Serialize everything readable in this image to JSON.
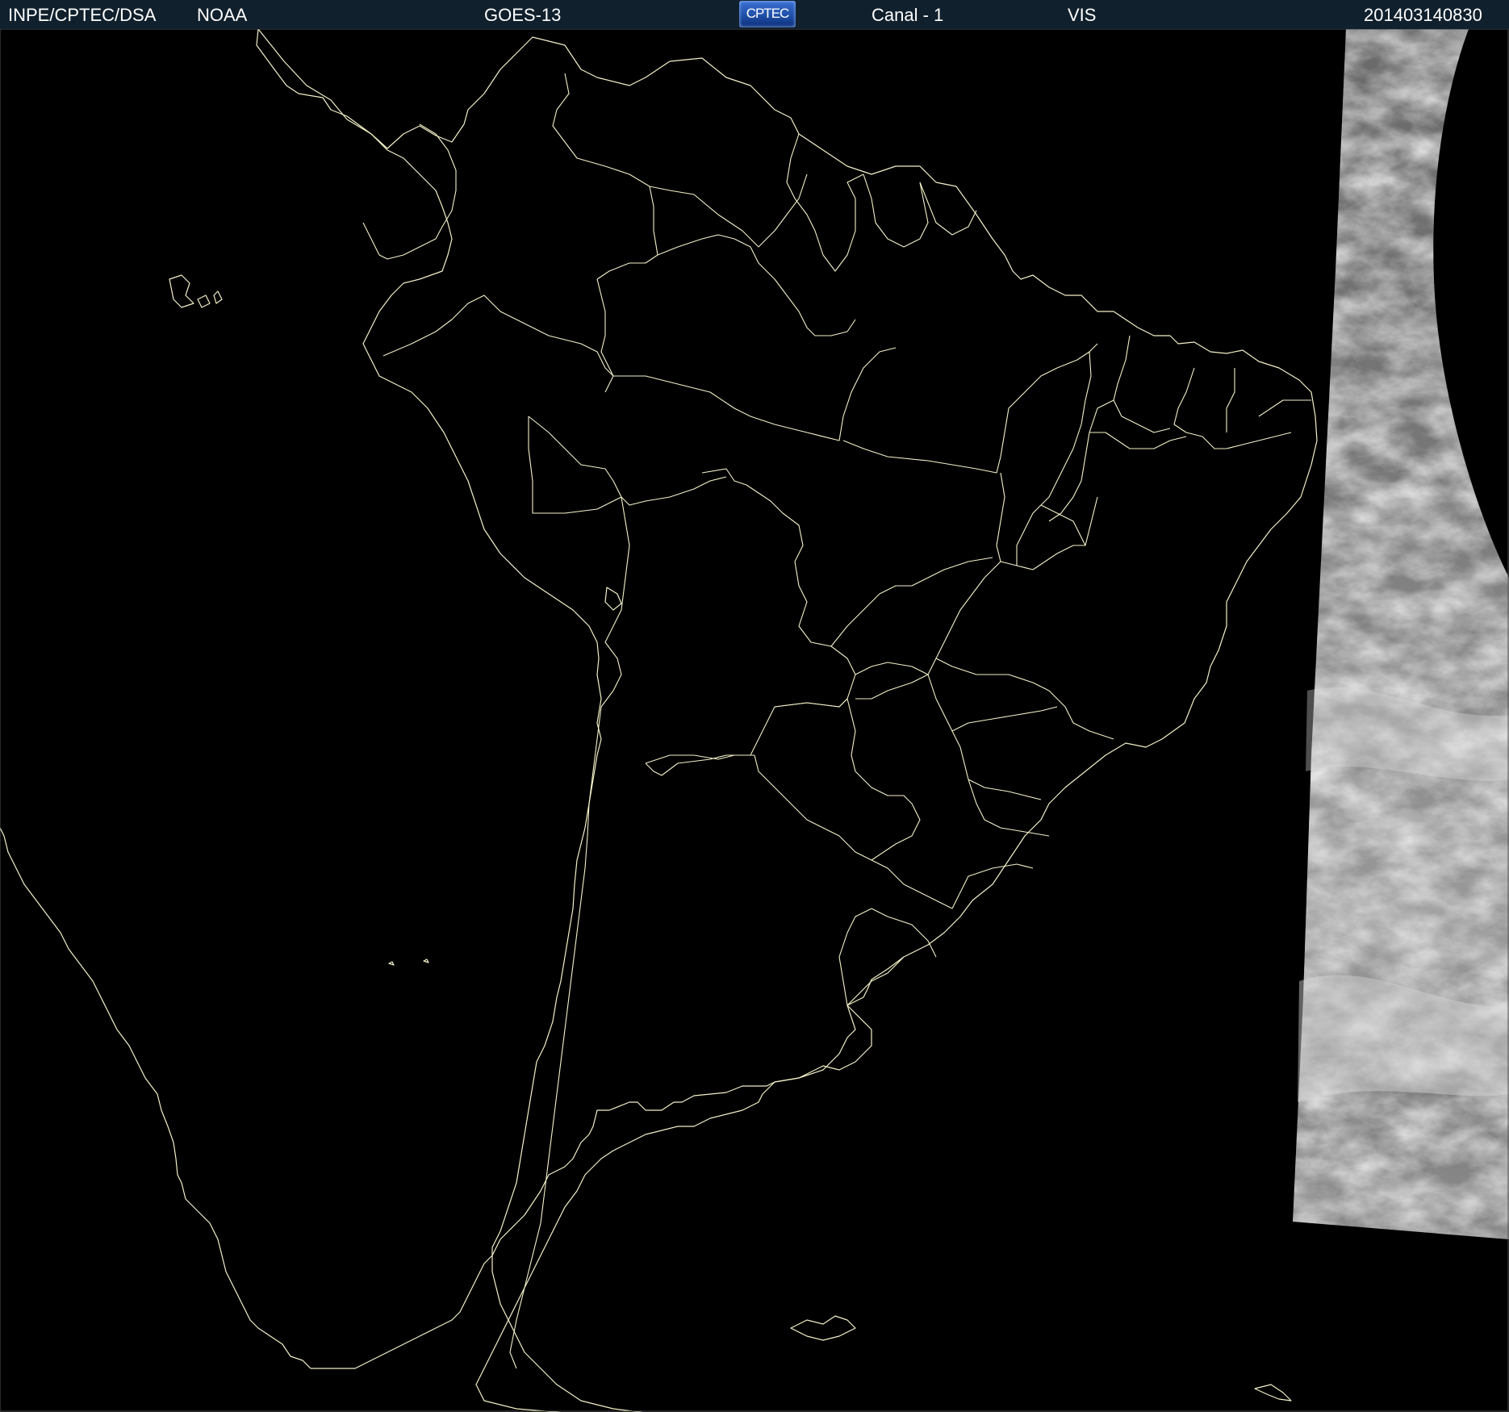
{
  "header": {
    "institution": "INPE/CPTEC/DSA",
    "agency": "NOAA",
    "satellite": "GOES-13",
    "logo_text": "CPTEC",
    "channel": "Canal - 1",
    "band": "VIS",
    "timestamp": "201403140830"
  },
  "colors": {
    "header_background": "#10202c",
    "map_background": "#000000",
    "coastline": "#f3f0c8",
    "cloud_light": "#e8e8e8",
    "cloud_dark": "#555555"
  },
  "map": {
    "features": [
      "coastline",
      "country-borders",
      "state-borders",
      "satellite-imagery-strip"
    ]
  }
}
